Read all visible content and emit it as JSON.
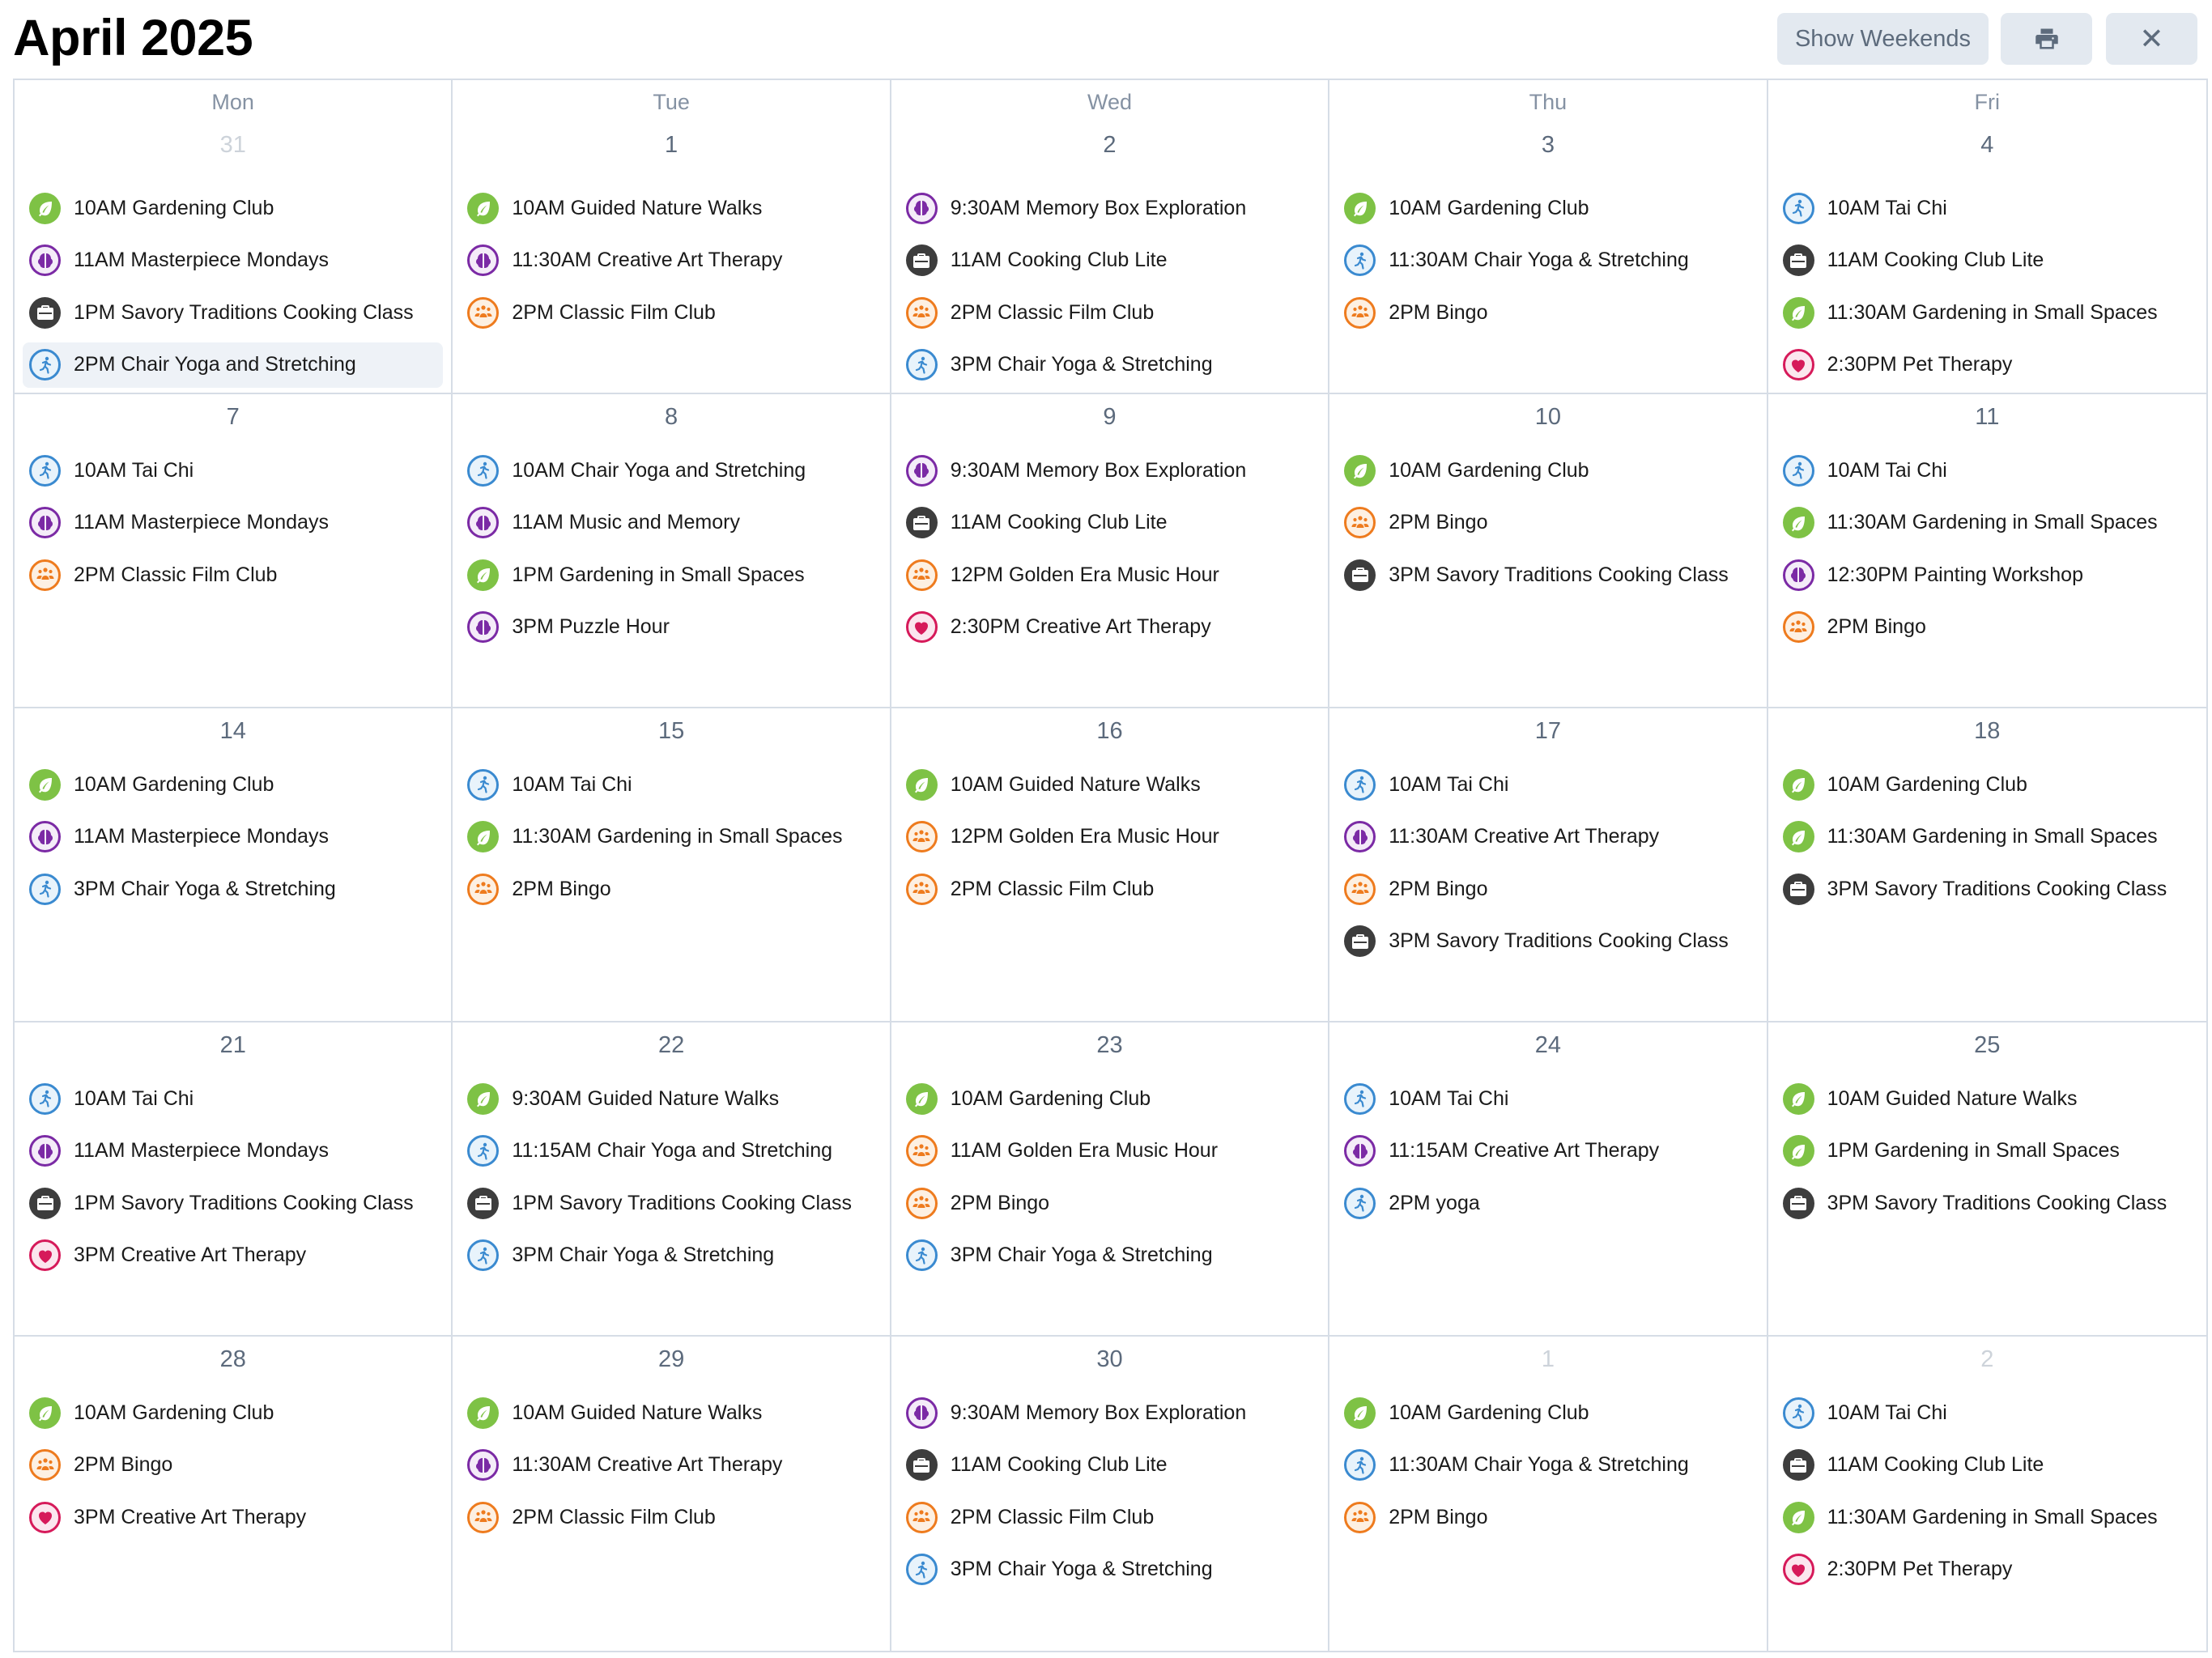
{
  "header": {
    "title": "April 2025",
    "show_weekends_label": "Show Weekends",
    "print_icon": "printer-icon",
    "close_icon": "close-icon",
    "close_glyph": "✕"
  },
  "weekdays": [
    "Mon",
    "Tue",
    "Wed",
    "Thu",
    "Fri"
  ],
  "category_icons": {
    "nature": {
      "icon": "leaf-icon",
      "color": "#7ec245"
    },
    "cooking": {
      "icon": "briefcase-icon",
      "color": "#3d3d3d"
    },
    "cognitive": {
      "icon": "brain-icon",
      "color": "#7b2aa5"
    },
    "fitness": {
      "icon": "person-walking-icon",
      "color": "#3a8ad0"
    },
    "social": {
      "icon": "group-icon",
      "color": "#ee7b1e"
    },
    "wellness": {
      "icon": "heart-icon",
      "color": "#d61a5a"
    }
  },
  "weeks": [
    [
      {
        "day": "31",
        "muted": true,
        "events": [
          {
            "text": "10AM Gardening Club",
            "cat": "nature"
          },
          {
            "text": "11AM Masterpiece Mondays",
            "cat": "cognitive"
          },
          {
            "text": "1PM Savory Traditions Cooking Class",
            "cat": "cooking"
          },
          {
            "text": "2PM Chair Yoga and Stretching",
            "cat": "fitness",
            "highlighted": true
          }
        ]
      },
      {
        "day": "1",
        "events": [
          {
            "text": "10AM Guided Nature Walks",
            "cat": "nature"
          },
          {
            "text": "11:30AM Creative Art Therapy",
            "cat": "cognitive"
          },
          {
            "text": "2PM Classic Film Club",
            "cat": "social"
          }
        ]
      },
      {
        "day": "2",
        "events": [
          {
            "text": "9:30AM Memory Box Exploration",
            "cat": "cognitive"
          },
          {
            "text": "11AM Cooking Club Lite",
            "cat": "cooking"
          },
          {
            "text": "2PM Classic Film Club",
            "cat": "social"
          },
          {
            "text": "3PM Chair Yoga & Stretching",
            "cat": "fitness"
          }
        ]
      },
      {
        "day": "3",
        "events": [
          {
            "text": "10AM Gardening Club",
            "cat": "nature"
          },
          {
            "text": "11:30AM Chair Yoga & Stretching",
            "cat": "fitness"
          },
          {
            "text": "2PM Bingo",
            "cat": "social"
          }
        ]
      },
      {
        "day": "4",
        "events": [
          {
            "text": "10AM Tai Chi",
            "cat": "fitness"
          },
          {
            "text": "11AM Cooking Club Lite",
            "cat": "cooking"
          },
          {
            "text": "11:30AM Gardening in Small Spaces",
            "cat": "nature"
          },
          {
            "text": "2:30PM Pet Therapy",
            "cat": "wellness"
          }
        ]
      }
    ],
    [
      {
        "day": "7",
        "events": [
          {
            "text": "10AM Tai Chi",
            "cat": "fitness"
          },
          {
            "text": "11AM Masterpiece Mondays",
            "cat": "cognitive"
          },
          {
            "text": "2PM Classic Film Club",
            "cat": "social"
          }
        ]
      },
      {
        "day": "8",
        "events": [
          {
            "text": "10AM Chair Yoga and Stretching",
            "cat": "fitness"
          },
          {
            "text": "11AM Music and Memory",
            "cat": "cognitive"
          },
          {
            "text": "1PM Gardening in Small Spaces",
            "cat": "nature"
          },
          {
            "text": "3PM Puzzle Hour",
            "cat": "cognitive"
          }
        ]
      },
      {
        "day": "9",
        "events": [
          {
            "text": "9:30AM Memory Box Exploration",
            "cat": "cognitive"
          },
          {
            "text": "11AM Cooking Club Lite",
            "cat": "cooking"
          },
          {
            "text": "12PM Golden Era Music Hour",
            "cat": "social"
          },
          {
            "text": "2:30PM Creative Art Therapy",
            "cat": "wellness"
          }
        ]
      },
      {
        "day": "10",
        "events": [
          {
            "text": "10AM Gardening Club",
            "cat": "nature"
          },
          {
            "text": "2PM Bingo",
            "cat": "social"
          },
          {
            "text": "3PM Savory Traditions Cooking Class",
            "cat": "cooking"
          }
        ]
      },
      {
        "day": "11",
        "events": [
          {
            "text": "10AM Tai Chi",
            "cat": "fitness"
          },
          {
            "text": "11:30AM Gardening in Small Spaces",
            "cat": "nature"
          },
          {
            "text": "12:30PM Painting Workshop",
            "cat": "cognitive"
          },
          {
            "text": "2PM Bingo",
            "cat": "social"
          }
        ]
      }
    ],
    [
      {
        "day": "14",
        "events": [
          {
            "text": "10AM Gardening Club",
            "cat": "nature"
          },
          {
            "text": "11AM Masterpiece Mondays",
            "cat": "cognitive"
          },
          {
            "text": "3PM Chair Yoga & Stretching",
            "cat": "fitness"
          }
        ]
      },
      {
        "day": "15",
        "events": [
          {
            "text": "10AM Tai Chi",
            "cat": "fitness"
          },
          {
            "text": "11:30AM Gardening in Small Spaces",
            "cat": "nature"
          },
          {
            "text": "2PM Bingo",
            "cat": "social"
          }
        ]
      },
      {
        "day": "16",
        "events": [
          {
            "text": "10AM Guided Nature Walks",
            "cat": "nature"
          },
          {
            "text": "12PM Golden Era Music Hour",
            "cat": "social"
          },
          {
            "text": "2PM Classic Film Club",
            "cat": "social"
          }
        ]
      },
      {
        "day": "17",
        "events": [
          {
            "text": "10AM Tai Chi",
            "cat": "fitness"
          },
          {
            "text": "11:30AM Creative Art Therapy",
            "cat": "cognitive"
          },
          {
            "text": "2PM Bingo",
            "cat": "social"
          },
          {
            "text": "3PM Savory Traditions Cooking Class",
            "cat": "cooking"
          }
        ]
      },
      {
        "day": "18",
        "events": [
          {
            "text": "10AM Gardening Club",
            "cat": "nature"
          },
          {
            "text": "11:30AM Gardening in Small Spaces",
            "cat": "nature"
          },
          {
            "text": "3PM Savory Traditions Cooking Class",
            "cat": "cooking"
          }
        ]
      }
    ],
    [
      {
        "day": "21",
        "events": [
          {
            "text": "10AM Tai Chi",
            "cat": "fitness"
          },
          {
            "text": "11AM Masterpiece Mondays",
            "cat": "cognitive"
          },
          {
            "text": "1PM Savory Traditions Cooking Class",
            "cat": "cooking"
          },
          {
            "text": "3PM Creative Art Therapy",
            "cat": "wellness"
          }
        ]
      },
      {
        "day": "22",
        "events": [
          {
            "text": "9:30AM Guided Nature Walks",
            "cat": "nature"
          },
          {
            "text": "11:15AM Chair Yoga and Stretching",
            "cat": "fitness"
          },
          {
            "text": "1PM Savory Traditions Cooking Class",
            "cat": "cooking"
          },
          {
            "text": "3PM Chair Yoga & Stretching",
            "cat": "fitness"
          }
        ]
      },
      {
        "day": "23",
        "events": [
          {
            "text": "10AM Gardening Club",
            "cat": "nature"
          },
          {
            "text": "11AM Golden Era Music Hour",
            "cat": "social"
          },
          {
            "text": "2PM Bingo",
            "cat": "social"
          },
          {
            "text": "3PM Chair Yoga & Stretching",
            "cat": "fitness"
          }
        ]
      },
      {
        "day": "24",
        "events": [
          {
            "text": "10AM Tai Chi",
            "cat": "fitness"
          },
          {
            "text": "11:15AM Creative Art Therapy",
            "cat": "cognitive"
          },
          {
            "text": "2PM yoga",
            "cat": "fitness"
          }
        ]
      },
      {
        "day": "25",
        "events": [
          {
            "text": "10AM Guided Nature Walks",
            "cat": "nature"
          },
          {
            "text": "1PM Gardening in Small Spaces",
            "cat": "nature"
          },
          {
            "text": "3PM Savory Traditions Cooking Class",
            "cat": "cooking"
          }
        ]
      }
    ],
    [
      {
        "day": "28",
        "events": [
          {
            "text": "10AM Gardening Club",
            "cat": "nature"
          },
          {
            "text": "2PM Bingo",
            "cat": "social"
          },
          {
            "text": "3PM Creative Art Therapy",
            "cat": "wellness"
          }
        ]
      },
      {
        "day": "29",
        "events": [
          {
            "text": "10AM Guided Nature Walks",
            "cat": "nature"
          },
          {
            "text": "11:30AM Creative Art Therapy",
            "cat": "cognitive"
          },
          {
            "text": "2PM Classic Film Club",
            "cat": "social"
          }
        ]
      },
      {
        "day": "30",
        "events": [
          {
            "text": "9:30AM Memory Box Exploration",
            "cat": "cognitive"
          },
          {
            "text": "11AM Cooking Club Lite",
            "cat": "cooking"
          },
          {
            "text": "2PM Classic Film Club",
            "cat": "social"
          },
          {
            "text": "3PM Chair Yoga & Stretching",
            "cat": "fitness"
          }
        ]
      },
      {
        "day": "1",
        "muted": true,
        "events": [
          {
            "text": "10AM Gardening Club",
            "cat": "nature"
          },
          {
            "text": "11:30AM Chair Yoga & Stretching",
            "cat": "fitness"
          },
          {
            "text": "2PM Bingo",
            "cat": "social"
          }
        ]
      },
      {
        "day": "2",
        "muted": true,
        "events": [
          {
            "text": "10AM Tai Chi",
            "cat": "fitness"
          },
          {
            "text": "11AM Cooking Club Lite",
            "cat": "cooking"
          },
          {
            "text": "11:30AM Gardening in Small Spaces",
            "cat": "nature"
          },
          {
            "text": "2:30PM Pet Therapy",
            "cat": "wellness"
          }
        ]
      }
    ]
  ]
}
